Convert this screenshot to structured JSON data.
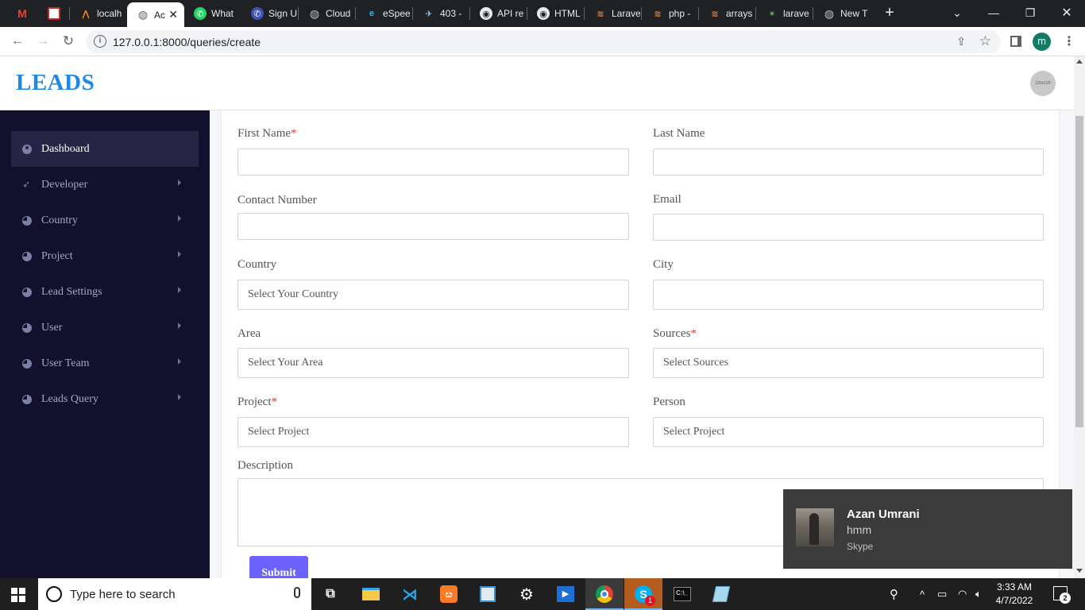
{
  "browser": {
    "tabs": [
      {
        "label": "",
        "icon": "gmail-icon"
      },
      {
        "label": "",
        "icon": "bookmark-icon"
      },
      {
        "label": "localh",
        "icon": "xampp-icon"
      },
      {
        "label": "Ac",
        "icon": "globe-icon",
        "active": true
      },
      {
        "label": "What",
        "icon": "whatsapp-icon"
      },
      {
        "label": "Sign U",
        "icon": "phone-icon"
      },
      {
        "label": "Cloud",
        "icon": "globe-icon"
      },
      {
        "label": "eSpee",
        "icon": "espeed-icon"
      },
      {
        "label": "403 -",
        "icon": "plane-icon"
      },
      {
        "label": "API re",
        "icon": "github-icon"
      },
      {
        "label": "HTML",
        "icon": "github-icon"
      },
      {
        "label": "Larave",
        "icon": "stackoverflow-icon"
      },
      {
        "label": "php -",
        "icon": "stackoverflow-icon"
      },
      {
        "label": "arrays",
        "icon": "stackoverflow-icon"
      },
      {
        "label": "larave",
        "icon": "laravel-icon"
      },
      {
        "label": "New T",
        "icon": "chrome-icon"
      }
    ],
    "new_tab": "+",
    "tab_close": "✕",
    "window_controls": {
      "tab_search": "⌄",
      "minimize": "—",
      "restore": "❐",
      "close": "✕"
    },
    "nav": {
      "back": "←",
      "forward": "→",
      "reload": "↻"
    },
    "info_glyph": "i",
    "url": "127.0.0.1:8000/queries/create",
    "share_glyph": "⇪",
    "star_glyph": "☆",
    "menu_glyph": "⋮",
    "profile_initial": "m",
    "profile_color": "#137a63"
  },
  "app": {
    "logo": "LEADS",
    "logo_color": "#1e88e5",
    "avatar_text": "120x120",
    "accent": "#6c63ff",
    "sidebar_bg": "#12102c"
  },
  "sidebar": {
    "items": [
      {
        "label": "Dashboard",
        "icon": "user-circle-icon",
        "active": true
      },
      {
        "label": "Developer",
        "icon": "rocket-icon"
      },
      {
        "label": "Country",
        "icon": "pie-chart-icon"
      },
      {
        "label": "Project",
        "icon": "pie-chart-icon"
      },
      {
        "label": "Lead Settings",
        "icon": "pie-chart-icon"
      },
      {
        "label": "User",
        "icon": "pie-chart-icon"
      },
      {
        "label": "User Team",
        "icon": "pie-chart-icon"
      },
      {
        "label": "Leads Query",
        "icon": "pie-chart-icon"
      }
    ]
  },
  "form": {
    "first_name": {
      "label": "First Name",
      "required": "*",
      "value": ""
    },
    "last_name": {
      "label": "Last Name",
      "value": ""
    },
    "contact_number": {
      "label": "Contact Number",
      "value": ""
    },
    "email": {
      "label": "Email",
      "value": ""
    },
    "country": {
      "label": "Country",
      "selected": "Select Your Country"
    },
    "city": {
      "label": "City",
      "value": ""
    },
    "area": {
      "label": "Area",
      "selected": "Select Your Area"
    },
    "sources": {
      "label": "Sources",
      "required": "*",
      "selected": "Select Sources"
    },
    "project": {
      "label": "Project",
      "required": "*",
      "selected": "Select Project"
    },
    "person": {
      "label": "Person",
      "selected": "Select Project"
    },
    "description": {
      "label": "Description",
      "value": ""
    },
    "submit_label": "Submit"
  },
  "toast": {
    "name": "Azan Umrani",
    "message": "hmm",
    "app": "Skype"
  },
  "taskbar": {
    "search_placeholder": "Type here to search",
    "apps": [
      "task-view-icon",
      "file-explorer-icon",
      "vscode-icon",
      "xampp-icon",
      "photos-icon",
      "settings-icon",
      "media-player-icon",
      "chrome-icon",
      "skype-icon",
      "terminal-icon",
      "notepad-icon"
    ],
    "skype_badge": "1",
    "time": "3:33 AM",
    "date": "4/7/2022",
    "notification_count": "2"
  }
}
